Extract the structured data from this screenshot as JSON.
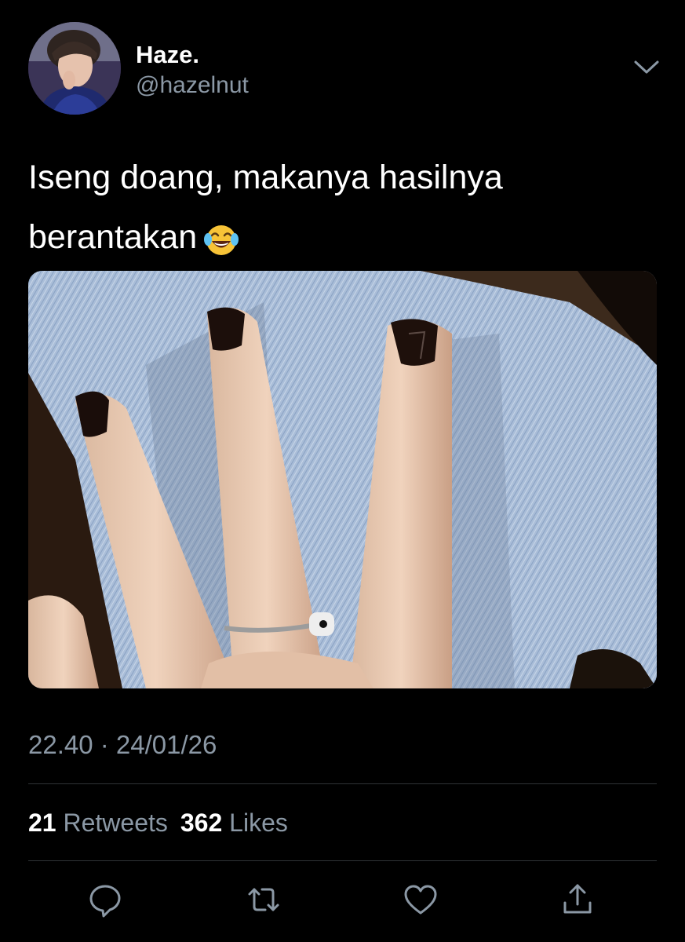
{
  "user": {
    "display_name": "Haze.",
    "handle": "@hazelnut"
  },
  "tweet": {
    "text_line1": "Iseng doang, makanya hasilnya",
    "text_line2": "berantakan",
    "emoji": "face-with-tears-of-joy",
    "timestamp": "22.40 · 24/01/26"
  },
  "stats": {
    "retweets_count": "21",
    "retweets_label": "Retweets",
    "likes_count": "362",
    "likes_label": "Likes"
  },
  "icons": {
    "menu": "chevron-down-icon",
    "reply": "reply-icon",
    "retweet": "retweet-icon",
    "like": "heart-icon",
    "share": "share-icon"
  },
  "colors": {
    "background": "#000000",
    "text_primary": "#ffffff",
    "text_secondary": "#8b98a5",
    "divider": "#2f3336"
  }
}
